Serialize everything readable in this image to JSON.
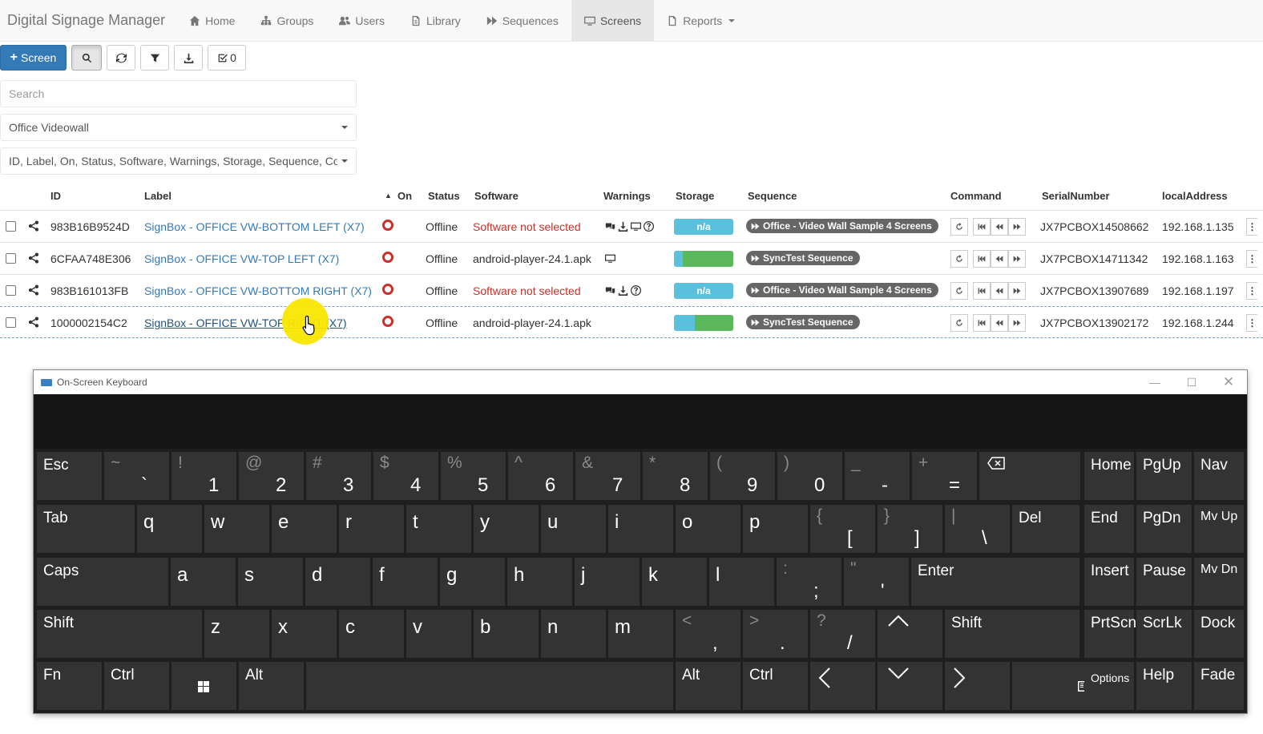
{
  "nav": {
    "brand": "Digital Signage Manager",
    "items": [
      {
        "label": "Home",
        "icon": "home-icon"
      },
      {
        "label": "Groups",
        "icon": "groups-icon"
      },
      {
        "label": "Users",
        "icon": "users-icon"
      },
      {
        "label": "Library",
        "icon": "library-icon"
      },
      {
        "label": "Sequences",
        "icon": "sequences-icon"
      },
      {
        "label": "Screens",
        "icon": "screens-icon",
        "active": true
      },
      {
        "label": "Reports",
        "icon": "reports-icon",
        "dropdown": true
      }
    ]
  },
  "toolbar": {
    "add_screen_label": "Screen",
    "selected_count": "0"
  },
  "filters": {
    "search_placeholder": "Search",
    "group_value": "Office Videowall",
    "columns_value": "ID, Label, On, Status, Software, Warnings, Storage, Sequence, Command, SerialNumber, localAddress"
  },
  "table": {
    "headers": {
      "id": "ID",
      "label": "Label",
      "on": "On",
      "status": "Status",
      "software": "Software",
      "warnings": "Warnings",
      "storage": "Storage",
      "sequence": "Sequence",
      "command": "Command",
      "serial": "SerialNumber",
      "address": "localAddress"
    },
    "rows": [
      {
        "id": "983B16B9524D",
        "label": "SignBox - OFFICE VW-BOTTOM LEFT (X7)",
        "status": "Offline",
        "software": "Software not selected",
        "storage_text": "n/a",
        "sequence": "Office - Video Wall Sample 4 Screens",
        "serial": "JX7PCBOX14508662",
        "address": "192.168.1.135"
      },
      {
        "id": "6CFAA748E306",
        "label": "SignBox - OFFICE VW-TOP LEFT (X7)",
        "status": "Offline",
        "software": "android-player-24.1.apk",
        "storage_text": "",
        "storage_fill": 0.85,
        "sequence": "SyncTest Sequence",
        "serial": "JX7PCBOX14711342",
        "address": "192.168.1.163"
      },
      {
        "id": "983B161013FB",
        "label": "SignBox - OFFICE VW-BOTTOM RIGHT (X7)",
        "status": "Offline",
        "software": "Software not selected",
        "storage_text": "n/a",
        "sequence": "Office - Video Wall Sample 4 Screens",
        "serial": "JX7PCBOX13907689",
        "address": "192.168.1.197"
      },
      {
        "id": "1000002154C2",
        "label": "SignBox - OFFICE VW-TOP RIGHT (X7)",
        "status": "Offline",
        "software": "android-player-24.1.apk",
        "storage_text": "",
        "storage_fill": 0.65,
        "sequence": "SyncTest Sequence",
        "serial": "JX7PCBOX13902172",
        "address": "192.168.1.244"
      }
    ]
  },
  "osk": {
    "title": "On-Screen Keyboard",
    "row1": [
      {
        "label": "Esc"
      },
      {
        "shift": "~",
        "main": "`"
      },
      {
        "shift": "!",
        "main": "1"
      },
      {
        "shift": "@",
        "main": "2"
      },
      {
        "shift": "#",
        "main": "3"
      },
      {
        "shift": "$",
        "main": "4"
      },
      {
        "shift": "%",
        "main": "5"
      },
      {
        "shift": "^",
        "main": "6"
      },
      {
        "shift": "&",
        "main": "7"
      },
      {
        "shift": "*",
        "main": "8"
      },
      {
        "shift": "(",
        "main": "9"
      },
      {
        "shift": ")",
        "main": "0"
      },
      {
        "shift": "_",
        "main": "-"
      },
      {
        "shift": "+",
        "main": "="
      }
    ],
    "row2": [
      "Tab",
      "q",
      "w",
      "e",
      "r",
      "t",
      "y",
      "u",
      "i",
      "o",
      "p"
    ],
    "row2_sym": [
      {
        "shift": "{",
        "main": "["
      },
      {
        "shift": "}",
        "main": "]"
      },
      {
        "shift": "|",
        "main": "\\"
      }
    ],
    "row2_del": "Del",
    "row3": [
      "Caps",
      "a",
      "s",
      "d",
      "f",
      "g",
      "h",
      "j",
      "k",
      "l"
    ],
    "row3_sym": [
      {
        "shift": ":",
        "main": ";"
      },
      {
        "shift": "\"",
        "main": "'"
      }
    ],
    "row3_enter": "Enter",
    "row4": [
      "Shift",
      "z",
      "x",
      "c",
      "v",
      "b",
      "n",
      "m"
    ],
    "row4_sym": [
      {
        "shift": "<",
        "main": ","
      },
      {
        "shift": ">",
        "main": "."
      },
      {
        "shift": "?",
        "main": "/"
      }
    ],
    "row4_shift_r": "Shift",
    "row5": {
      "fn": "Fn",
      "ctrl": "Ctrl",
      "alt": "Alt",
      "alt_r": "Alt",
      "ctrl_r": "Ctrl"
    },
    "side": [
      [
        "Home",
        "PgUp",
        "Nav"
      ],
      [
        "End",
        "PgDn",
        "Mv Up"
      ],
      [
        "Insert",
        "Pause",
        "Mv Dn"
      ],
      [
        "PrtScn",
        "ScrLk",
        "Dock"
      ],
      [
        "Options",
        "Help",
        "Fade"
      ]
    ]
  }
}
